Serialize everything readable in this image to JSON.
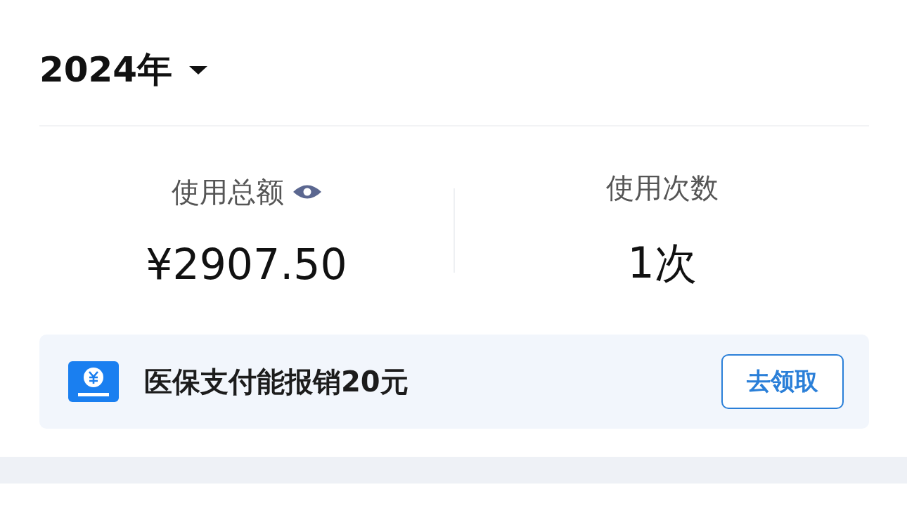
{
  "year_selector": {
    "label": "2024年"
  },
  "stats": [
    {
      "kind": "amount",
      "label": "使用总额",
      "value": "¥2907.50"
    },
    {
      "kind": "count",
      "label": "使用次数",
      "value": "1次"
    }
  ],
  "banner": {
    "text": "医保支付能报销20元",
    "button": "去领取"
  }
}
